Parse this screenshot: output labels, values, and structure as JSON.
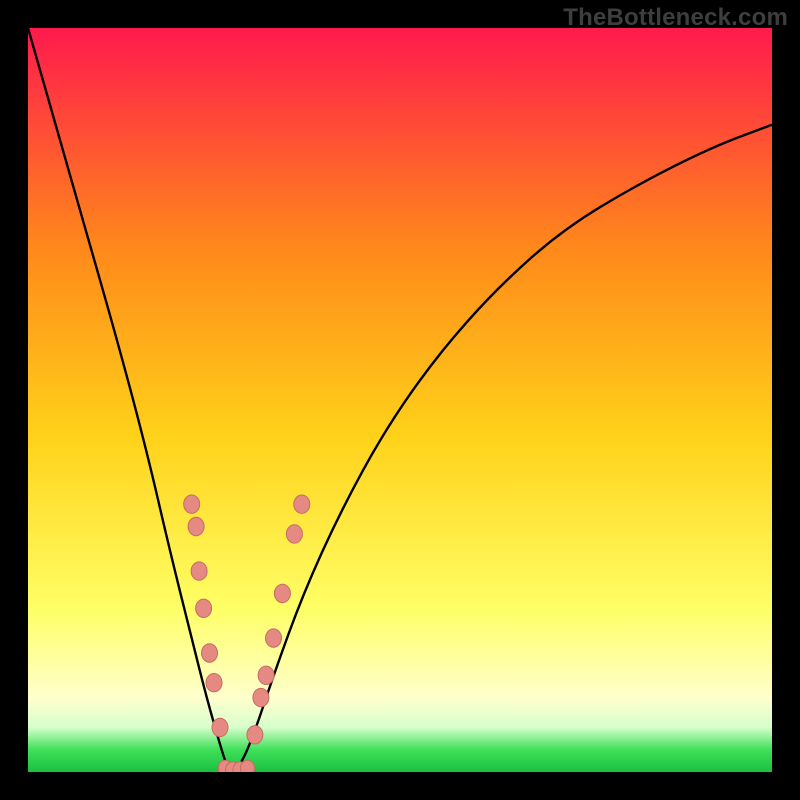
{
  "watermark": "TheBottleneck.com",
  "colors": {
    "black": "#000000",
    "curve": "#000000",
    "dot_fill": "#e58a83",
    "dot_stroke": "#c96a62",
    "grad_top": "#ff1a4d",
    "grad_mid_upper": "#ff8a1a",
    "grad_mid": "#ffd21a",
    "grad_lower": "#ffff66",
    "grad_pale": "#ffffcc",
    "grad_green_pale": "#d6ffcc",
    "grad_green": "#3fe05a",
    "grad_green_deep": "#1abf3f"
  },
  "chart_data": {
    "type": "line",
    "title": "",
    "xlabel": "",
    "ylabel": "",
    "xlim": [
      0,
      100
    ],
    "ylim": [
      0,
      100
    ],
    "x_min_at": 27,
    "curve_points": [
      {
        "x": 0,
        "y": 0
      },
      {
        "x": 4,
        "y": 14
      },
      {
        "x": 8,
        "y": 28
      },
      {
        "x": 12,
        "y": 42
      },
      {
        "x": 16,
        "y": 57
      },
      {
        "x": 19,
        "y": 70
      },
      {
        "x": 22,
        "y": 82
      },
      {
        "x": 24,
        "y": 90
      },
      {
        "x": 26,
        "y": 97
      },
      {
        "x": 27,
        "y": 100
      },
      {
        "x": 28,
        "y": 100
      },
      {
        "x": 30,
        "y": 96
      },
      {
        "x": 33,
        "y": 87
      },
      {
        "x": 37,
        "y": 76
      },
      {
        "x": 42,
        "y": 65
      },
      {
        "x": 48,
        "y": 54
      },
      {
        "x": 55,
        "y": 44
      },
      {
        "x": 63,
        "y": 35
      },
      {
        "x": 72,
        "y": 27
      },
      {
        "x": 82,
        "y": 21
      },
      {
        "x": 92,
        "y": 16
      },
      {
        "x": 100,
        "y": 13
      }
    ],
    "left_dots": [
      {
        "x": 22.0,
        "y": 64
      },
      {
        "x": 22.6,
        "y": 67
      },
      {
        "x": 23.0,
        "y": 73
      },
      {
        "x": 23.6,
        "y": 78
      },
      {
        "x": 24.4,
        "y": 84
      },
      {
        "x": 25.0,
        "y": 88
      },
      {
        "x": 25.8,
        "y": 94
      }
    ],
    "bottom_dots": [
      {
        "x": 26.5,
        "y": 99.5
      },
      {
        "x": 27.5,
        "y": 99.7
      },
      {
        "x": 28.5,
        "y": 99.7
      },
      {
        "x": 29.5,
        "y": 99.5
      }
    ],
    "right_dots": [
      {
        "x": 30.5,
        "y": 95
      },
      {
        "x": 31.3,
        "y": 90
      },
      {
        "x": 32.0,
        "y": 87
      },
      {
        "x": 33.0,
        "y": 82
      },
      {
        "x": 34.2,
        "y": 76
      },
      {
        "x": 35.8,
        "y": 68
      },
      {
        "x": 36.8,
        "y": 64
      }
    ]
  }
}
